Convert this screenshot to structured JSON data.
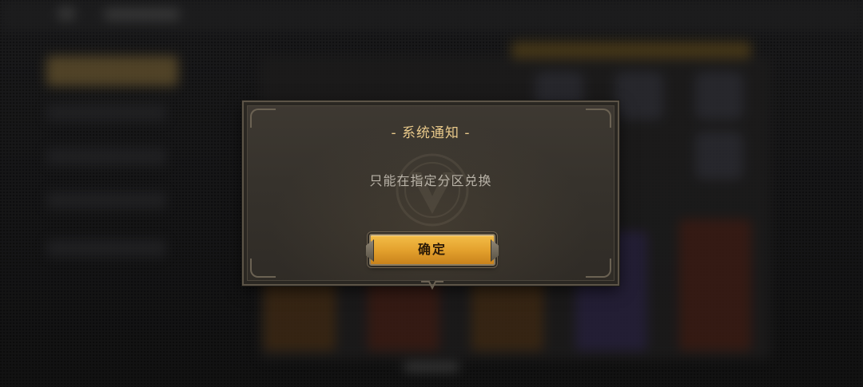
{
  "dialog": {
    "title": "- 系统通知 -",
    "message": "只能在指定分区兑换",
    "confirm_label": "确定"
  },
  "colors": {
    "title_gold": "#e9c98a",
    "button_gold": "#e4a22e",
    "message_gray": "#b9b3a8",
    "panel_bg": "#36322c"
  },
  "icons": {
    "emblem": "faction-emblem-icon",
    "corner": "corner-ornament-icon"
  }
}
